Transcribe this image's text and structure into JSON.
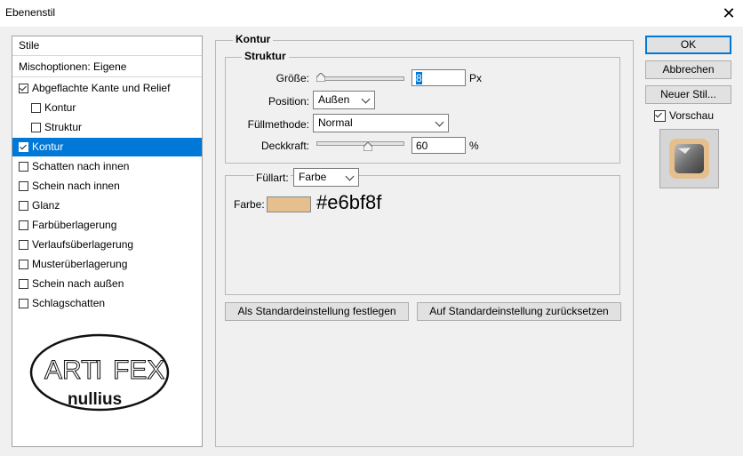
{
  "window": {
    "title": "Ebenenstil",
    "close_glyph": "✕"
  },
  "left_panel": {
    "header": "Stile",
    "blend_options": "Mischoptionen: Eigene",
    "items": [
      {
        "label": "Abgeflachte Kante und Relief",
        "checked": true,
        "indent": false
      },
      {
        "label": "Kontur",
        "checked": false,
        "indent": true
      },
      {
        "label": "Struktur",
        "checked": false,
        "indent": true
      },
      {
        "label": "Kontur",
        "checked": true,
        "indent": false,
        "selected": true
      },
      {
        "label": "Schatten nach innen",
        "checked": false,
        "indent": false
      },
      {
        "label": "Schein nach innen",
        "checked": false,
        "indent": false
      },
      {
        "label": "Glanz",
        "checked": false,
        "indent": false
      },
      {
        "label": "Farbüberlagerung",
        "checked": false,
        "indent": false
      },
      {
        "label": "Verlaufsüberlagerung",
        "checked": false,
        "indent": false
      },
      {
        "label": "Musterüberlagerung",
        "checked": false,
        "indent": false
      },
      {
        "label": "Schein nach außen",
        "checked": false,
        "indent": false
      },
      {
        "label": "Schlagschatten",
        "checked": false,
        "indent": false
      }
    ],
    "logo": {
      "line1_left": "ART",
      "line1_mid": "I",
      "line1_right": "FEX",
      "line2": "nullius"
    }
  },
  "kontur": {
    "title": "Kontur",
    "struktur": {
      "title": "Struktur",
      "size_label": "Größe:",
      "size_value": "8",
      "size_unit": "Px",
      "size_level": 0.05,
      "position_label": "Position:",
      "position_value": "Außen",
      "fill_method_label": "Füllmethode:",
      "fill_method_value": "Normal",
      "opacity_label": "Deckkraft:",
      "opacity_value": "60",
      "opacity_unit": "%",
      "opacity_level": 0.6
    },
    "fill": {
      "type_label": "Füllart:",
      "type_value": "Farbe",
      "color_label": "Farbe:",
      "color_hex_text": "#e6bf8f",
      "color": "#e6bf8f"
    },
    "buttons": {
      "set_default": "Als Standardeinstellung festlegen",
      "reset_default": "Auf Standardeinstellung zurücksetzen"
    }
  },
  "right": {
    "ok": "OK",
    "cancel": "Abbrechen",
    "new_style": "Neuer Stil...",
    "preview_label": "Vorschau",
    "preview_checked": true
  }
}
